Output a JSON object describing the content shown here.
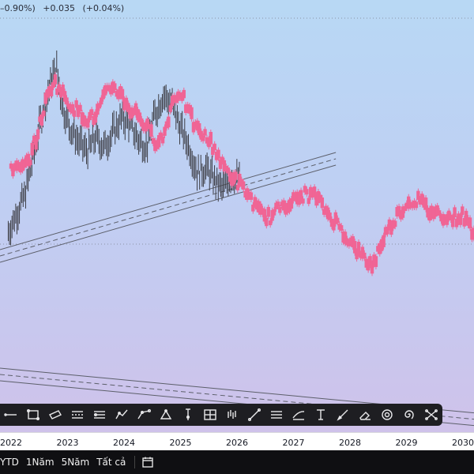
{
  "header": {
    "change_partial": "–0.90%)",
    "change_abs": "+0.035",
    "change_pct": "(+0.04%)"
  },
  "chart_data": {
    "type": "line",
    "title": "",
    "series": [
      {
        "style": "grey-candles",
        "x": [
          2021.95,
          2022.1,
          2022.25,
          2022.4,
          2022.55,
          2022.7,
          2022.8,
          2022.92,
          2023.05,
          2023.2,
          2023.35,
          2023.5,
          2023.65,
          2023.8,
          2023.95,
          2024.1,
          2024.25,
          2024.4,
          2024.55,
          2024.7,
          2024.85,
          2025.0,
          2025.15,
          2025.3,
          2025.45,
          2025.6,
          2025.75,
          2025.9,
          2026.05
        ],
        "values": [
          0.22,
          0.3,
          0.38,
          0.55,
          0.72,
          0.85,
          0.92,
          0.74,
          0.66,
          0.6,
          0.56,
          0.62,
          0.58,
          0.64,
          0.7,
          0.68,
          0.61,
          0.58,
          0.72,
          0.8,
          0.76,
          0.66,
          0.58,
          0.47,
          0.49,
          0.44,
          0.4,
          0.46,
          0.44
        ]
      },
      {
        "style": "pink-candles",
        "x": [
          2022.0,
          2022.15,
          2022.3,
          2022.45,
          2022.6,
          2022.75,
          2022.9,
          2023.05,
          2023.2,
          2023.35,
          2023.5,
          2023.65,
          2023.8,
          2023.95,
          2024.1,
          2024.25,
          2024.4,
          2024.55,
          2024.7,
          2024.85,
          2025.0,
          2025.15,
          2025.3,
          2025.45,
          2025.6,
          2025.75,
          2025.9,
          2026.05,
          2026.2,
          2026.4,
          2026.6,
          2026.8,
          2027.0,
          2027.2,
          2027.4,
          2027.6,
          2027.8,
          2028.0,
          2028.2,
          2028.4,
          2028.6,
          2028.8,
          2029.0,
          2029.2,
          2029.4,
          2029.6,
          2029.8,
          2030.0,
          2030.15,
          2030.3
        ],
        "values": [
          0.5,
          0.48,
          0.51,
          0.62,
          0.76,
          0.86,
          0.81,
          0.76,
          0.73,
          0.7,
          0.71,
          0.79,
          0.84,
          0.8,
          0.74,
          0.72,
          0.66,
          0.61,
          0.62,
          0.77,
          0.82,
          0.72,
          0.65,
          0.62,
          0.58,
          0.5,
          0.46,
          0.42,
          0.38,
          0.3,
          0.28,
          0.34,
          0.35,
          0.38,
          0.37,
          0.3,
          0.25,
          0.18,
          0.12,
          0.08,
          0.2,
          0.28,
          0.34,
          0.36,
          0.31,
          0.3,
          0.28,
          0.29,
          0.24,
          0.17
        ]
      }
    ],
    "channel_upper": {
      "x": [
        2022.0,
        2027.75
      ],
      "y": [
        0.12,
        0.53
      ]
    },
    "channel_lower": {
      "x": [
        2022.0,
        2030.25
      ],
      "y": [
        -0.38,
        -0.57
      ]
    },
    "x_ticks": [
      "2022",
      "2023",
      "2024",
      "2025",
      "2026",
      "2027",
      "2028",
      "2029",
      "2030"
    ],
    "grid": false
  },
  "toolbar": {
    "tools": [
      {
        "icon": "line-icon",
        "name": "tool-line"
      },
      {
        "icon": "rectangle-icon",
        "name": "tool-rectangle"
      },
      {
        "icon": "parallelogram-icon",
        "name": "tool-parallelogram"
      },
      {
        "icon": "parallel-channel-icon",
        "name": "tool-parallel-channel"
      },
      {
        "icon": "regression-channel-icon",
        "name": "tool-regression-channel"
      },
      {
        "icon": "path-icon",
        "name": "tool-path"
      },
      {
        "icon": "polyline-icon",
        "name": "tool-polyline"
      },
      {
        "icon": "triangle-pattern-icon",
        "name": "tool-triangle-pattern"
      },
      {
        "icon": "long-position-icon",
        "name": "tool-long-position"
      },
      {
        "icon": "date-range-icon",
        "name": "tool-date-range"
      },
      {
        "icon": "bars-pattern-icon",
        "name": "tool-bars-pattern"
      },
      {
        "icon": "trend-line-icon",
        "name": "tool-trend-line"
      },
      {
        "icon": "horizontal-lines-icon",
        "name": "tool-horizontal-lines"
      },
      {
        "icon": "fib-channel-icon",
        "name": "tool-fib-channel"
      },
      {
        "icon": "text-cursor-icon",
        "name": "tool-text"
      },
      {
        "icon": "brush-icon",
        "name": "tool-brush"
      },
      {
        "icon": "eraser-icon",
        "name": "tool-eraser"
      },
      {
        "icon": "target-icon",
        "name": "tool-target"
      },
      {
        "icon": "spiral-icon",
        "name": "tool-spiral"
      },
      {
        "icon": "network-icon",
        "name": "tool-network"
      }
    ]
  },
  "ranges": [
    "YTD",
    "1Năm",
    "5Năm",
    "Tất cả"
  ],
  "colors": {
    "pink": "#f06595",
    "grey": "#3d3d44",
    "channel": "#5c5f6a"
  }
}
